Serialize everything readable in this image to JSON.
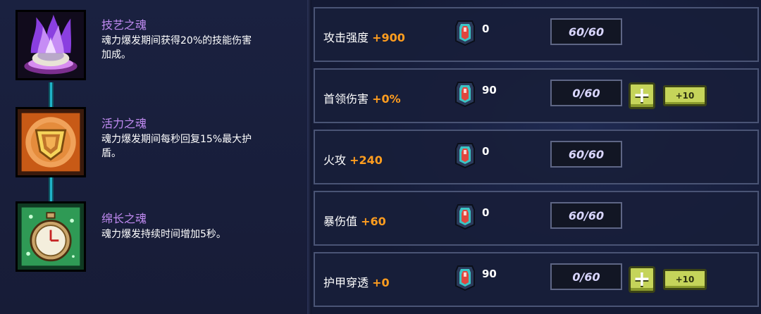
{
  "souls": [
    {
      "name": "技艺之魂",
      "desc_line1": "魂力爆发期间获得20%的技能伤害",
      "desc_line2": "加成。",
      "icon": "purple-flame-icon"
    },
    {
      "name": "活力之魂",
      "desc_line1": "魂力爆发期间每秒回复15%最大护",
      "desc_line2": "盾。",
      "icon": "golden-shield-icon"
    },
    {
      "name": "绵长之魂",
      "desc_line1": "魂力爆发持续时间增加5秒。",
      "desc_line2": "",
      "icon": "stopwatch-icon"
    }
  ],
  "stats": [
    {
      "label": "攻击强度",
      "bonus": "+900",
      "gems": "0",
      "level": "60/60",
      "can_upgrade": false
    },
    {
      "label": "首领伤害",
      "bonus": "+0%",
      "gems": "90",
      "level": "0/60",
      "can_upgrade": true
    },
    {
      "label": "火攻",
      "bonus": "+240",
      "gems": "0",
      "level": "60/60",
      "can_upgrade": false
    },
    {
      "label": "暴伤值",
      "bonus": "+60",
      "gems": "0",
      "level": "60/60",
      "can_upgrade": false
    },
    {
      "label": "护甲穿透",
      "bonus": "+0",
      "gems": "90",
      "level": "0/60",
      "can_upgrade": true
    }
  ],
  "buttons": {
    "plus_glyph": "+",
    "plus10_label": "+10"
  },
  "colors": {
    "bonus": "#ff9d1f",
    "soul_name": "#c18bf2",
    "button": "#c5d45a",
    "connector": "#1fb2c9"
  }
}
